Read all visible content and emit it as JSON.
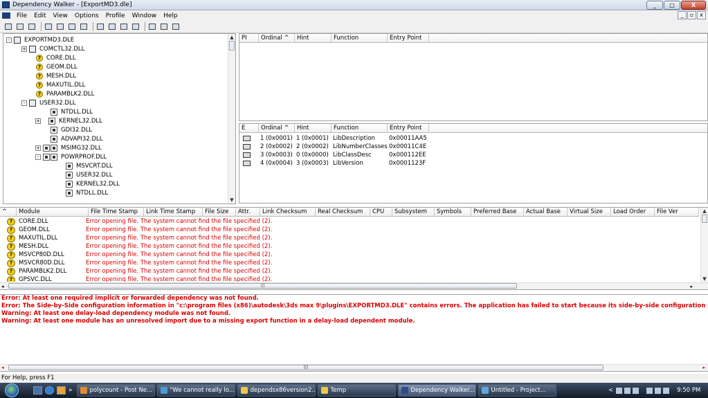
{
  "window": {
    "title": "Dependency Walker - [ExportMD3.dle]",
    "controls": [
      "_",
      "□",
      "X"
    ]
  },
  "menubar": {
    "items": [
      "File",
      "Edit",
      "View",
      "Options",
      "Profile",
      "Window",
      "Help"
    ],
    "mdi_controls": [
      "_",
      "▫",
      "x"
    ]
  },
  "toolbar": {
    "buttons": [
      "open-icon",
      "save-icon",
      "copy-icon",
      "full-paths-icon",
      "undecorate-icon",
      "find-icon",
      "properties-icon",
      "view-module-icon",
      "auto-expand-icon",
      "expand-all-icon",
      "collapse-all-icon",
      "minimize-icon",
      "tile-icon",
      "help-icon"
    ]
  },
  "tree": {
    "nodes": [
      {
        "label": "EXPORTMD3.DLE",
        "icon": "module",
        "expander": "-"
      },
      {
        "label": "COMCTL32.DLL",
        "icon": "module",
        "expander": "+"
      },
      {
        "label": "CORE.DLL",
        "icon": "missing",
        "expander": ""
      },
      {
        "label": "GEOM.DLL",
        "icon": "missing",
        "expander": ""
      },
      {
        "label": "MESH.DLL",
        "icon": "missing",
        "expander": ""
      },
      {
        "label": "MAXUTIL.DLL",
        "icon": "missing",
        "expander": ""
      },
      {
        "label": "PARAMBLK2.DLL",
        "icon": "missing",
        "expander": ""
      },
      {
        "label": "USER32.DLL",
        "icon": "module",
        "expander": "-"
      },
      {
        "label": "NTDLL.DLL",
        "icon": "dll",
        "expander": ""
      },
      {
        "label": "KERNEL32.DLL",
        "icon": "dll",
        "expander": "+"
      },
      {
        "label": "GDI32.DLL",
        "icon": "dll",
        "expander": ""
      },
      {
        "label": "ADVAPI32.DLL",
        "icon": "dll",
        "expander": ""
      },
      {
        "label": "MSIMG32.DLL",
        "icon": "dll-multi",
        "expander": "+"
      },
      {
        "label": "POWRPROF.DLL",
        "icon": "dll-multi",
        "expander": "-"
      },
      {
        "label": "MSVCRT.DLL",
        "icon": "dll",
        "expander": ""
      },
      {
        "label": "USER32.DLL",
        "icon": "dll",
        "expander": ""
      },
      {
        "label": "KERNEL32.DLL",
        "icon": "dll",
        "expander": ""
      },
      {
        "label": "NTDLL.DLL",
        "icon": "dll",
        "expander": ""
      }
    ]
  },
  "imports": {
    "headers": [
      "PI",
      "Ordinal ^",
      "Hint",
      "Function",
      "Entry Point"
    ]
  },
  "exports": {
    "headers": [
      "E",
      "Ordinal ^",
      "Hint",
      "Function",
      "Entry Point"
    ],
    "rows": [
      {
        "ordinal": "1 (0x0001)",
        "hint": "1 (0x0001)",
        "function": "LibDescription",
        "entry": "0x00011AA5"
      },
      {
        "ordinal": "2 (0x0002)",
        "hint": "2 (0x0002)",
        "function": "LibNumberClasses",
        "entry": "0x00011C4E"
      },
      {
        "ordinal": "3 (0x0003)",
        "hint": "0 (0x0000)",
        "function": "LibClassDesc",
        "entry": "0x000112EE"
      },
      {
        "ordinal": "4 (0x0004)",
        "hint": "3 (0x0003)",
        "function": "LibVersion",
        "entry": "0x0001123F"
      }
    ]
  },
  "modules": {
    "headers": [
      "^",
      "Module",
      "File Time Stamp",
      "Link Time Stamp",
      "File Size",
      "Attr.",
      "Link Checksum",
      "Real Checksum",
      "CPU",
      "Subsystem",
      "Symbols",
      "Preferred Base",
      "Actual Base",
      "Virtual Size",
      "Load Order",
      "File Ver"
    ],
    "rows": [
      {
        "name": "CORE.DLL",
        "error": "Error opening file. The system cannot find the file specified (2)."
      },
      {
        "name": "GEOM.DLL",
        "error": "Error opening file. The system cannot find the file specified (2)."
      },
      {
        "name": "MAXUTIL.DLL",
        "error": "Error opening file. The system cannot find the file specified (2)."
      },
      {
        "name": "MESH.DLL",
        "error": "Error opening file. The system cannot find the file specified (2)."
      },
      {
        "name": "MSVCP80D.DLL",
        "error": "Error opening file. The system cannot find the file specified (2)."
      },
      {
        "name": "MSVCR80D.DLL",
        "error": "Error opening file. The system cannot find the file specified (2)."
      },
      {
        "name": "PARAMBLK2.DLL",
        "error": "Error opening file. The system cannot find the file specified (2)."
      },
      {
        "name": "GPSVC.DLL",
        "error": "Error opening file. The system cannot find the file specified (2)."
      }
    ]
  },
  "log": {
    "lines": [
      "Error: At least one required implicit or forwarded dependency was not found.",
      "Error: The Side-by-Side configuration information in \"c:\\program files (x86)\\autodesk\\3ds max 9\\plugins\\EXPORTMD3.DLE\" contains errors. The application has failed to start because its side-by-side configuration is incorrect. Please see the applic",
      "Warning: At least one delay-load dependency module was not found.",
      "Warning: At least one module has an unresolved import due to a missing export function in a delay-load dependent module."
    ]
  },
  "status": {
    "text": "For Help, press F1"
  },
  "taskbar": {
    "buttons": [
      {
        "label": "polycount - Post Ne..."
      },
      {
        "label": "\"We cannot really lo..."
      },
      {
        "label": "dependsx86version2..."
      },
      {
        "label": "Temp"
      },
      {
        "label": "Dependency Walker..."
      },
      {
        "label": "Untitled    - Project..."
      }
    ],
    "overflow": "»",
    "clock": "9:50 PM",
    "tray_arrow": "<"
  }
}
